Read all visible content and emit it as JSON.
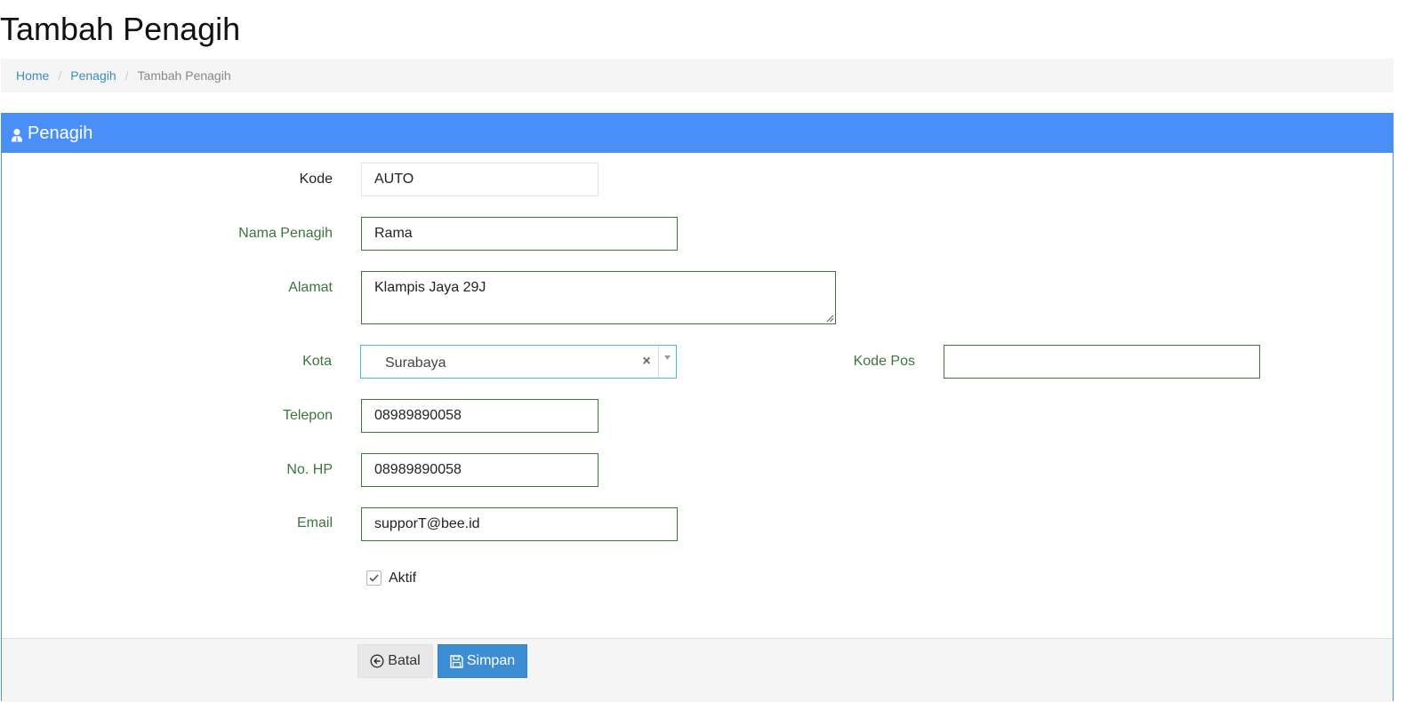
{
  "page": {
    "title": "Tambah Penagih"
  },
  "breadcrumb": {
    "items": [
      {
        "label": "Home"
      },
      {
        "label": "Penagih"
      },
      {
        "label": "Tambah Penagih"
      }
    ],
    "separator": "/"
  },
  "panel": {
    "title": "Penagih",
    "title_icon": "user-tie-icon"
  },
  "form": {
    "kode": {
      "label": "Kode",
      "value": "AUTO"
    },
    "nama": {
      "label": "Nama Penagih",
      "value": "Rama"
    },
    "alamat": {
      "label": "Alamat",
      "value": "Klampis Jaya 29J"
    },
    "kota": {
      "label": "Kota",
      "value": "Surabaya",
      "clear": "×"
    },
    "kode_pos": {
      "label": "Kode Pos",
      "value": ""
    },
    "telepon": {
      "label": "Telepon",
      "value": "08989890058"
    },
    "hp": {
      "label": "No. HP",
      "value": "08989890058"
    },
    "email": {
      "label": "Email",
      "value": "supporT@bee.id"
    },
    "aktif": {
      "label": "Aktif",
      "checked": true
    }
  },
  "footer": {
    "cancel_label": "Batal",
    "cancel_icon": "arrow-circle-left-icon",
    "save_label": "Simpan",
    "save_icon": "floppy-disk-icon"
  },
  "colors": {
    "panel_header": "#4a8ff7",
    "label_green": "#3c763d",
    "link_blue": "#3c8dbc",
    "primary_button": "#3c8dd3"
  }
}
